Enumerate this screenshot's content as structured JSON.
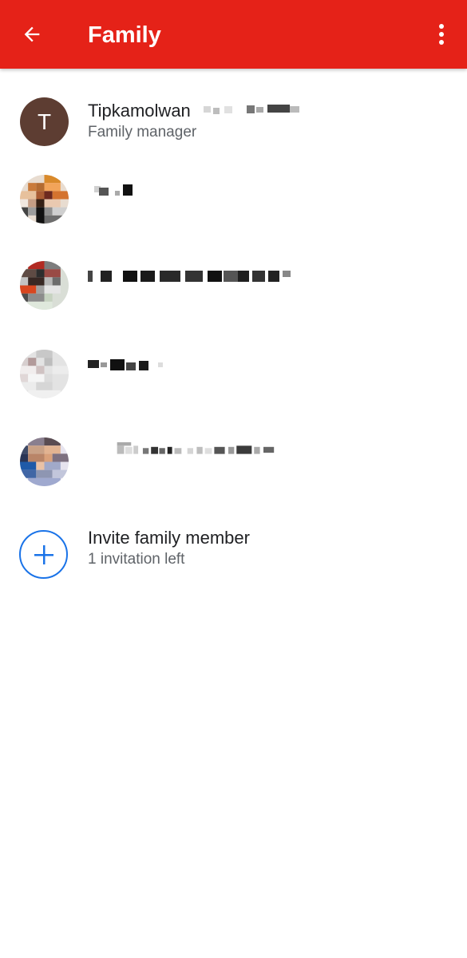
{
  "app_bar": {
    "title": "Family",
    "back_icon": "arrow-back-icon",
    "menu_icon": "more-vert-icon",
    "background": "#e52218"
  },
  "members": [
    {
      "initial": "T",
      "name": "Tipkamolwan",
      "role": "Family manager",
      "avatar_color": "#5d3d32"
    }
  ],
  "invite": {
    "label": "Invite family member",
    "detail": "1 invitation left",
    "icon": "add-circle-icon",
    "accent": "#1a73e8"
  }
}
